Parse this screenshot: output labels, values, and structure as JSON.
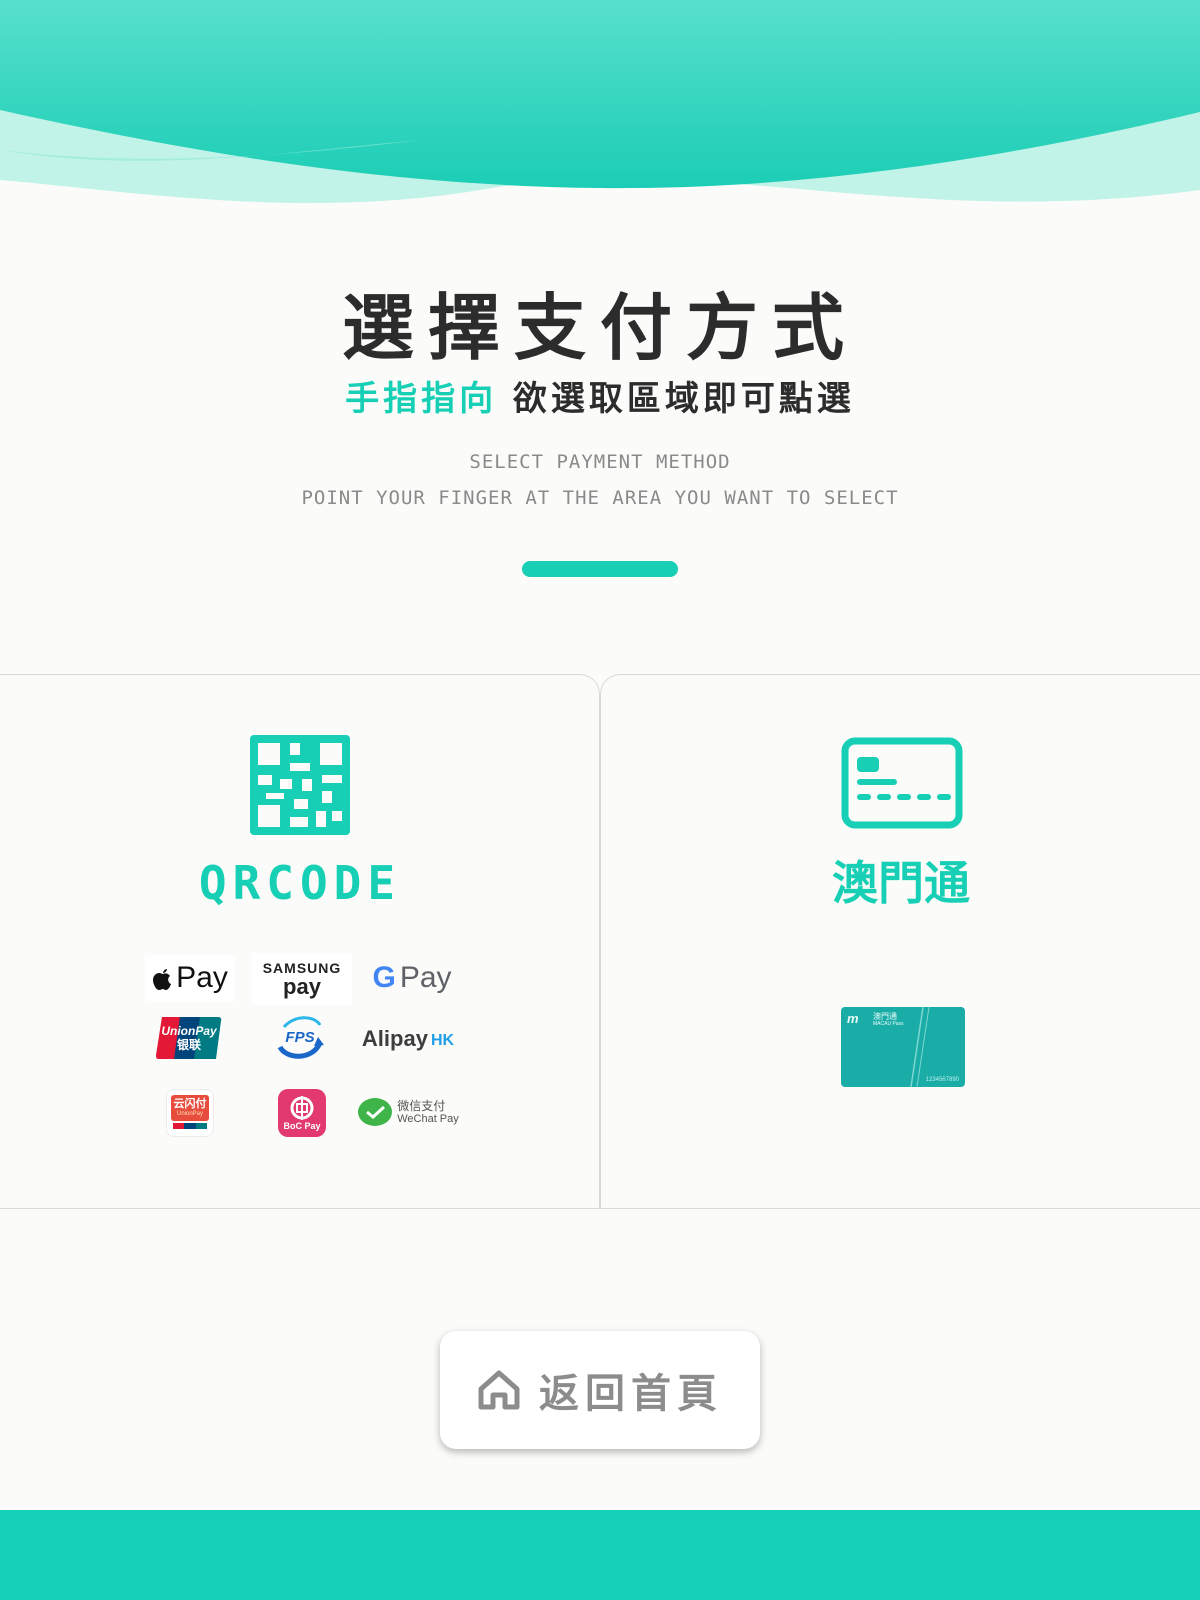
{
  "colors": {
    "accent": "#16cfb4",
    "title": "#2c2c2c",
    "muted": "#8a8a8a",
    "footer": "#16d1b9"
  },
  "header": {
    "title": "選擇支付方式",
    "subtitle_accent": "手指指向",
    "subtitle_rest": "欲選取區域即可點選",
    "en_title": "SELECT PAYMENT METHOD",
    "en_subtitle": "POINT YOUR FINGER AT THE AREA YOU WANT TO SELECT"
  },
  "options": {
    "qrcode": {
      "title": "QRCODE",
      "icon": "qrcode-icon",
      "logos": {
        "apple_pay": "Pay",
        "samsung_top": "SAMSUNG",
        "samsung_bottom": "pay",
        "google_g": "G",
        "google_pay": "Pay",
        "unionpay_top": "UnionPay",
        "unionpay_bottom": "银联",
        "fps": "FPS",
        "alipay": "Alipay",
        "alipay_hk": "HK",
        "yunshanfu": "云闪付",
        "yunshanfu_sub": "UnionPay",
        "bocpay": "BoC Pay",
        "wechat_cn": "微信支付",
        "wechat_en": "WeChat Pay"
      }
    },
    "macau_pass": {
      "title": "澳門通",
      "icon": "card-icon",
      "card_brand_cn": "澳門通",
      "card_brand_en": "MACAU Pass",
      "card_number": "1234567890"
    }
  },
  "home_button": {
    "label": "返回首頁",
    "icon": "home-icon"
  }
}
